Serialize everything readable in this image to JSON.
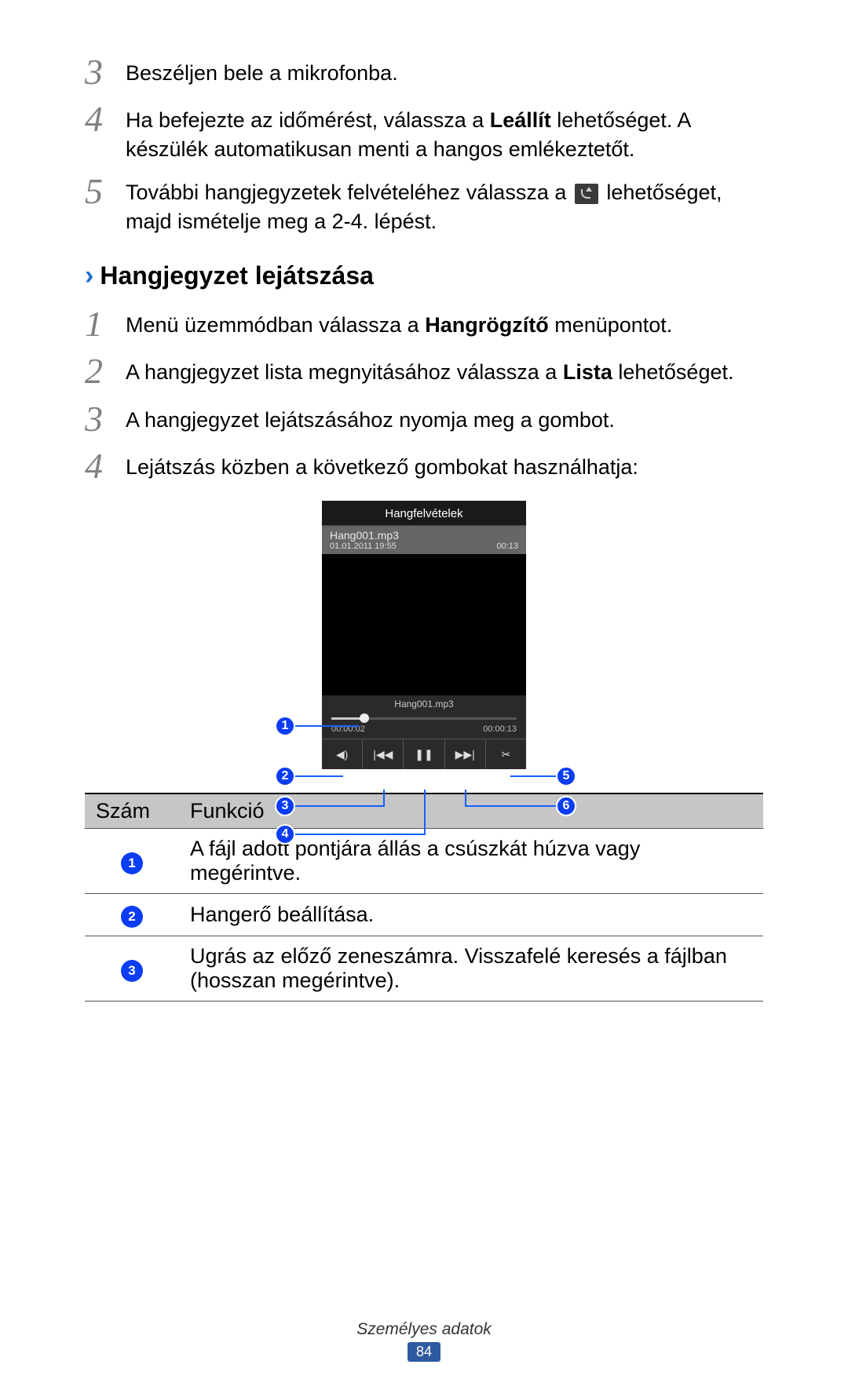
{
  "steps_top": {
    "s3": {
      "num": "3",
      "text": "Beszéljen bele a mikrofonba."
    },
    "s4": {
      "num": "4",
      "pre": "Ha befejezte az időmérést, válassza a ",
      "bold": "Leállít",
      "post": " lehetőséget. A készülék automatikusan menti a hangos emlékeztetőt."
    },
    "s5": {
      "num": "5",
      "pre": "További hangjegyzetek felvételéhez válassza a ",
      "post": " lehetőséget, majd ismételje meg a 2-4. lépést."
    }
  },
  "section": {
    "chev": "›",
    "title": "Hangjegyzet lejátszása"
  },
  "steps_play": {
    "s1": {
      "num": "1",
      "pre": "Menü üzemmódban válassza a ",
      "bold": "Hangrögzítő",
      "post": " menüpontot."
    },
    "s2": {
      "num": "2",
      "pre": "A hangjegyzet lista megnyitásához válassza a ",
      "bold": "Lista",
      "post": " lehetőséget."
    },
    "s3": {
      "num": "3",
      "text": "A hangjegyzet lejátszásához nyomja meg a gombot."
    },
    "s4": {
      "num": "4",
      "text": "Lejátszás közben a következő gombokat használhatja:"
    }
  },
  "phone": {
    "title": "Hangfelvételek",
    "file": "Hang001.mp3",
    "date": "01.01.2011 19:55",
    "dur": "00:13",
    "now_playing": "Hang001.mp3",
    "elapsed": "00:00:02",
    "total": "00:00:13",
    "controls": {
      "vol": "◀)",
      "prev": "|◀◀",
      "pause": "❚❚",
      "next": "▶▶|",
      "cut": "✂"
    }
  },
  "callouts": {
    "c1": "1",
    "c2": "2",
    "c3": "3",
    "c4": "4",
    "c5": "5",
    "c6": "6"
  },
  "table": {
    "head_num": "Szám",
    "head_func": "Funkció",
    "r1": {
      "n": "1",
      "t": "A fájl adott pontjára állás a csúszkát húzva vagy megérintve."
    },
    "r2": {
      "n": "2",
      "t": "Hangerő beállítása."
    },
    "r3": {
      "n": "3",
      "t": "Ugrás az előző zeneszámra. Visszafelé keresés a fájlban (hosszan megérintve)."
    }
  },
  "footer": {
    "section": "Személyes adatok",
    "page": "84"
  }
}
